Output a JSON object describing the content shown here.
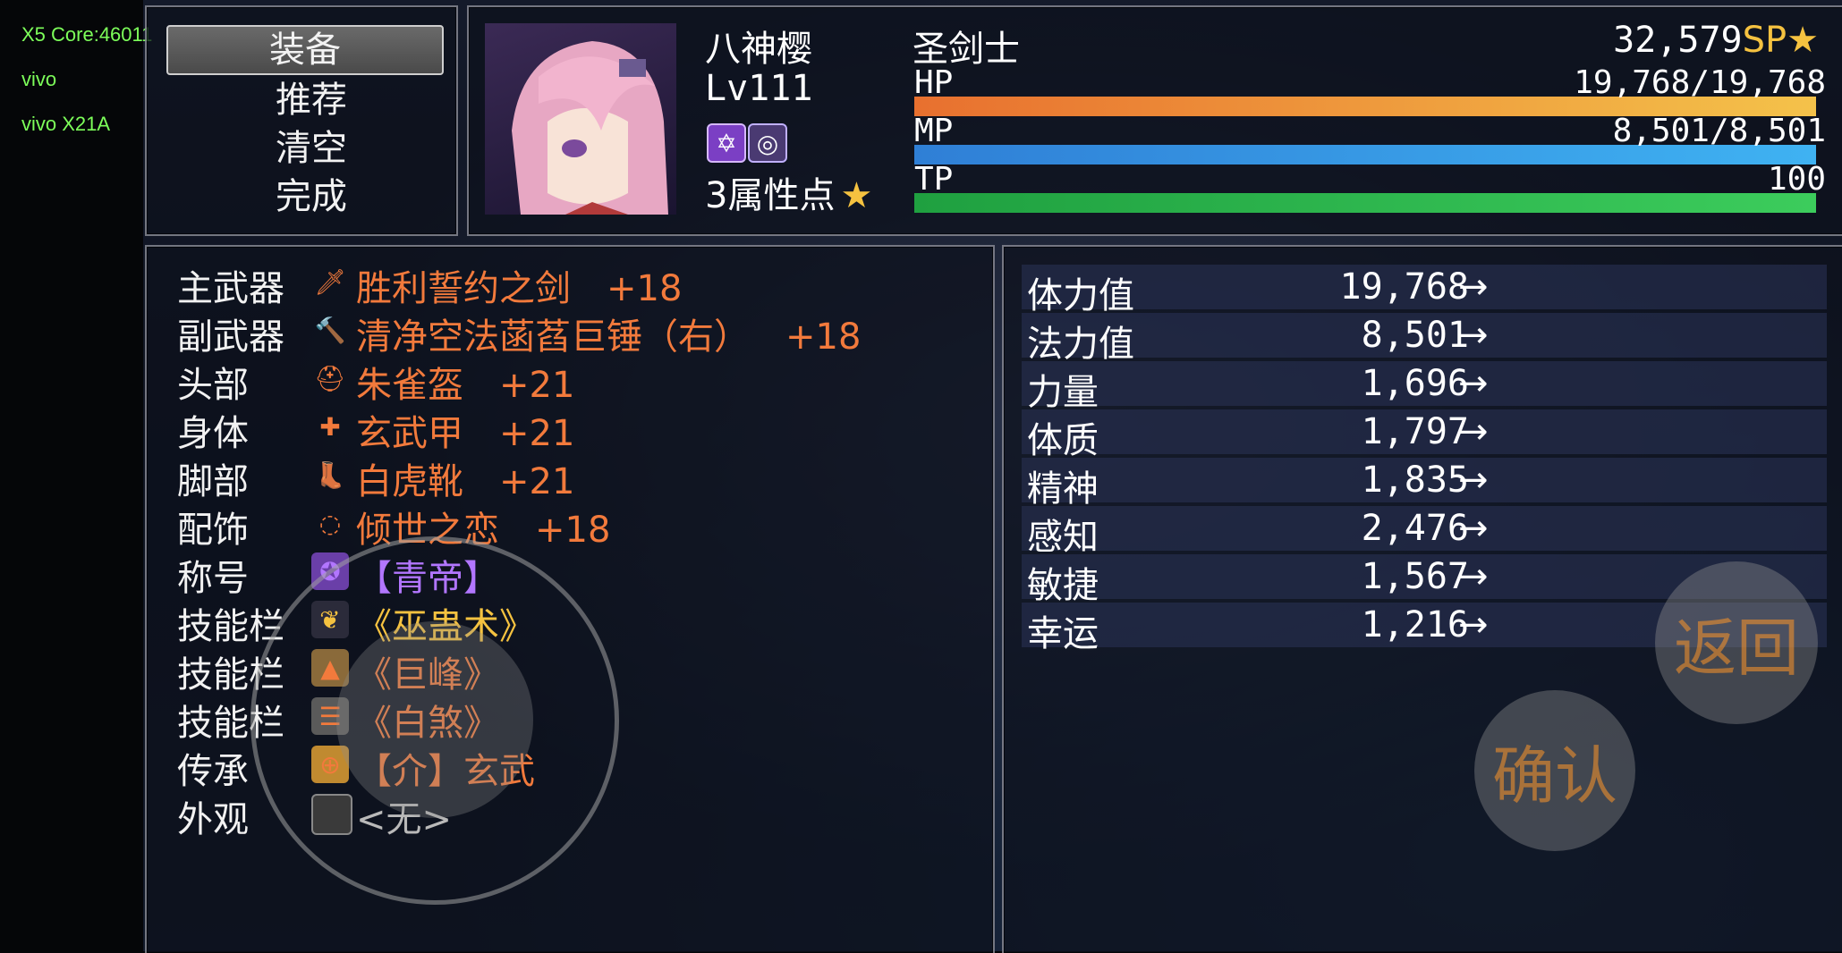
{
  "debug": {
    "line1": "X5 Core:46011",
    "line2": "vivo",
    "line3": "vivo X21A"
  },
  "commands": [
    "装备",
    "推荐",
    "清空",
    "完成"
  ],
  "actor": {
    "name": "八神樱",
    "class": "圣剑士",
    "level": "Lv111",
    "attr_points": "3属性点",
    "sp": "32,579",
    "sp_label": "SP",
    "hp_label": "HP",
    "hp_value": "19,768/19,768",
    "hp_fraction": 1.0,
    "mp_label": "MP",
    "mp_value": "8,501/8,501",
    "mp_fraction": 1.0,
    "tp_label": "TP",
    "tp_value": "100",
    "tp_fraction": 1.0
  },
  "equipment": [
    {
      "slot": "主武器",
      "item": "胜利誓约之剑",
      "bonus": "+18",
      "icon": "sword-icon",
      "color": "orange"
    },
    {
      "slot": "副武器",
      "item": "清净空法菡萏巨锤（右）",
      "bonus": "+18",
      "icon": "hammer-icon",
      "color": "orange"
    },
    {
      "slot": "头部",
      "item": "朱雀盔",
      "bonus": "+21",
      "icon": "helmet-icon",
      "color": "orange"
    },
    {
      "slot": "身体",
      "item": "玄武甲",
      "bonus": "+21",
      "icon": "armor-icon",
      "color": "orange"
    },
    {
      "slot": "脚部",
      "item": "白虎靴",
      "bonus": "+21",
      "icon": "boots-icon",
      "color": "orange"
    },
    {
      "slot": "配饰",
      "item": "倾世之恋",
      "bonus": "+18",
      "icon": "necklace-icon",
      "color": "orange"
    },
    {
      "slot": "称号",
      "item": "【青帝】",
      "bonus": "",
      "icon": "title-badge-icon",
      "color": "violet"
    },
    {
      "slot": "技能栏",
      "item": "《巫蛊术》",
      "bonus": "",
      "icon": "feather-skill-icon",
      "color": "gold"
    },
    {
      "slot": "技能栏",
      "item": "《巨峰》",
      "bonus": "",
      "icon": "rock-skill-icon",
      "color": "orange"
    },
    {
      "slot": "技能栏",
      "item": "《白煞》",
      "bonus": "",
      "icon": "scroll-skill-icon",
      "color": "orange"
    },
    {
      "slot": "传承",
      "item": "【介】玄武",
      "bonus": "",
      "icon": "inheritance-icon",
      "color": "orange"
    },
    {
      "slot": "外观",
      "item": "<无>",
      "bonus": "",
      "icon": "empty-slot-icon",
      "color": "grey"
    }
  ],
  "stats": [
    {
      "name": "体力值",
      "value": "19,768",
      "arrow": "→"
    },
    {
      "name": "法力值",
      "value": "8,501",
      "arrow": "→"
    },
    {
      "name": "力量",
      "value": "1,696",
      "arrow": "→"
    },
    {
      "name": "体质",
      "value": "1,797",
      "arrow": "→"
    },
    {
      "name": "精神",
      "value": "1,835",
      "arrow": "→"
    },
    {
      "name": "感知",
      "value": "2,476",
      "arrow": "→"
    },
    {
      "name": "敏捷",
      "value": "1,567",
      "arrow": "→"
    },
    {
      "name": "幸运",
      "value": "1,216",
      "arrow": "→"
    }
  ],
  "buttons": {
    "back": "返回",
    "confirm": "确认"
  },
  "colors": {
    "orange": "#f27a3c",
    "gold": "#f5c240",
    "violet": "#b276ff",
    "hp": "#f0a040",
    "mp": "#3aa0e8",
    "tp": "#28b848"
  }
}
